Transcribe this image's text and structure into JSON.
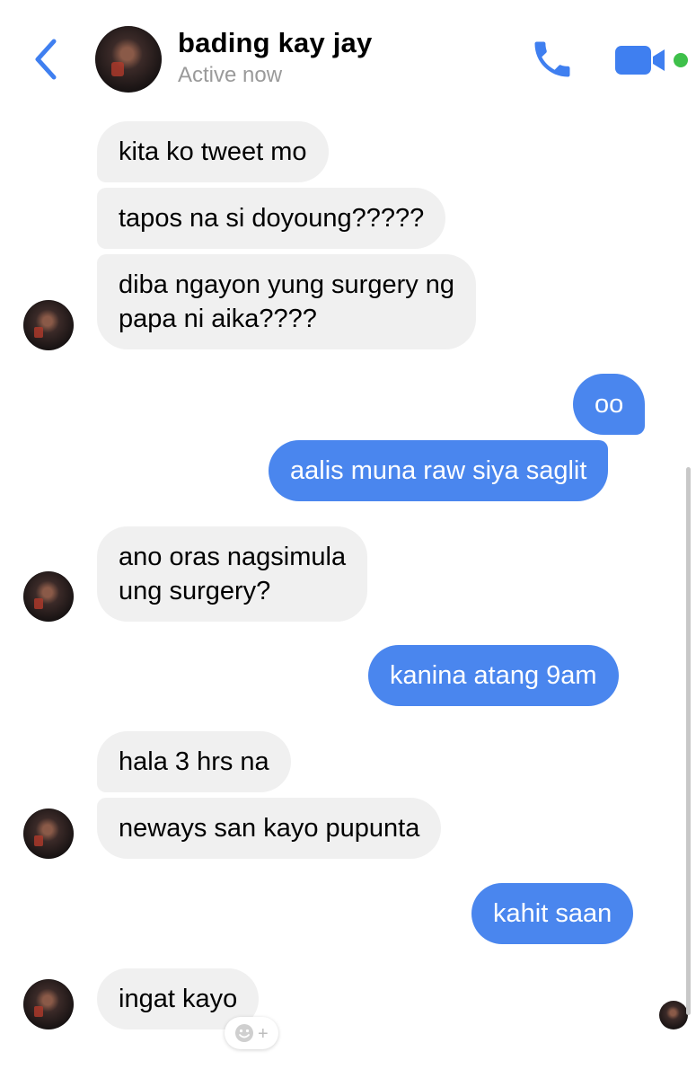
{
  "header": {
    "contact_name": "bading kay jay",
    "status": "Active now",
    "icons": [
      "back-chevron-icon",
      "phone-icon",
      "video-camera-icon"
    ],
    "online_color": "#3ec04a",
    "accent_color": "#4a86ee"
  },
  "messages": [
    {
      "from": "them",
      "text": "kita ko tweet mo"
    },
    {
      "from": "them",
      "text": "tapos na si doyoung?????"
    },
    {
      "from": "them",
      "line1": "diba ngayon yung surgery ng",
      "line2": "papa ni aika????"
    },
    {
      "from": "me",
      "text": "oo"
    },
    {
      "from": "me",
      "text": "aalis muna raw siya saglit"
    },
    {
      "from": "them",
      "line1": "ano oras nagsimula",
      "line2": "ung surgery?"
    },
    {
      "from": "me",
      "text": "kanina atang 9am"
    },
    {
      "from": "them",
      "text": "hala 3 hrs na"
    },
    {
      "from": "them",
      "text": "neways san kayo pupunta"
    },
    {
      "from": "me",
      "text": "kahit saan"
    },
    {
      "from": "them",
      "text": "ingat kayo"
    }
  ],
  "reaction_button": {
    "icon": "smiley-add-icon",
    "symbol": "+"
  }
}
